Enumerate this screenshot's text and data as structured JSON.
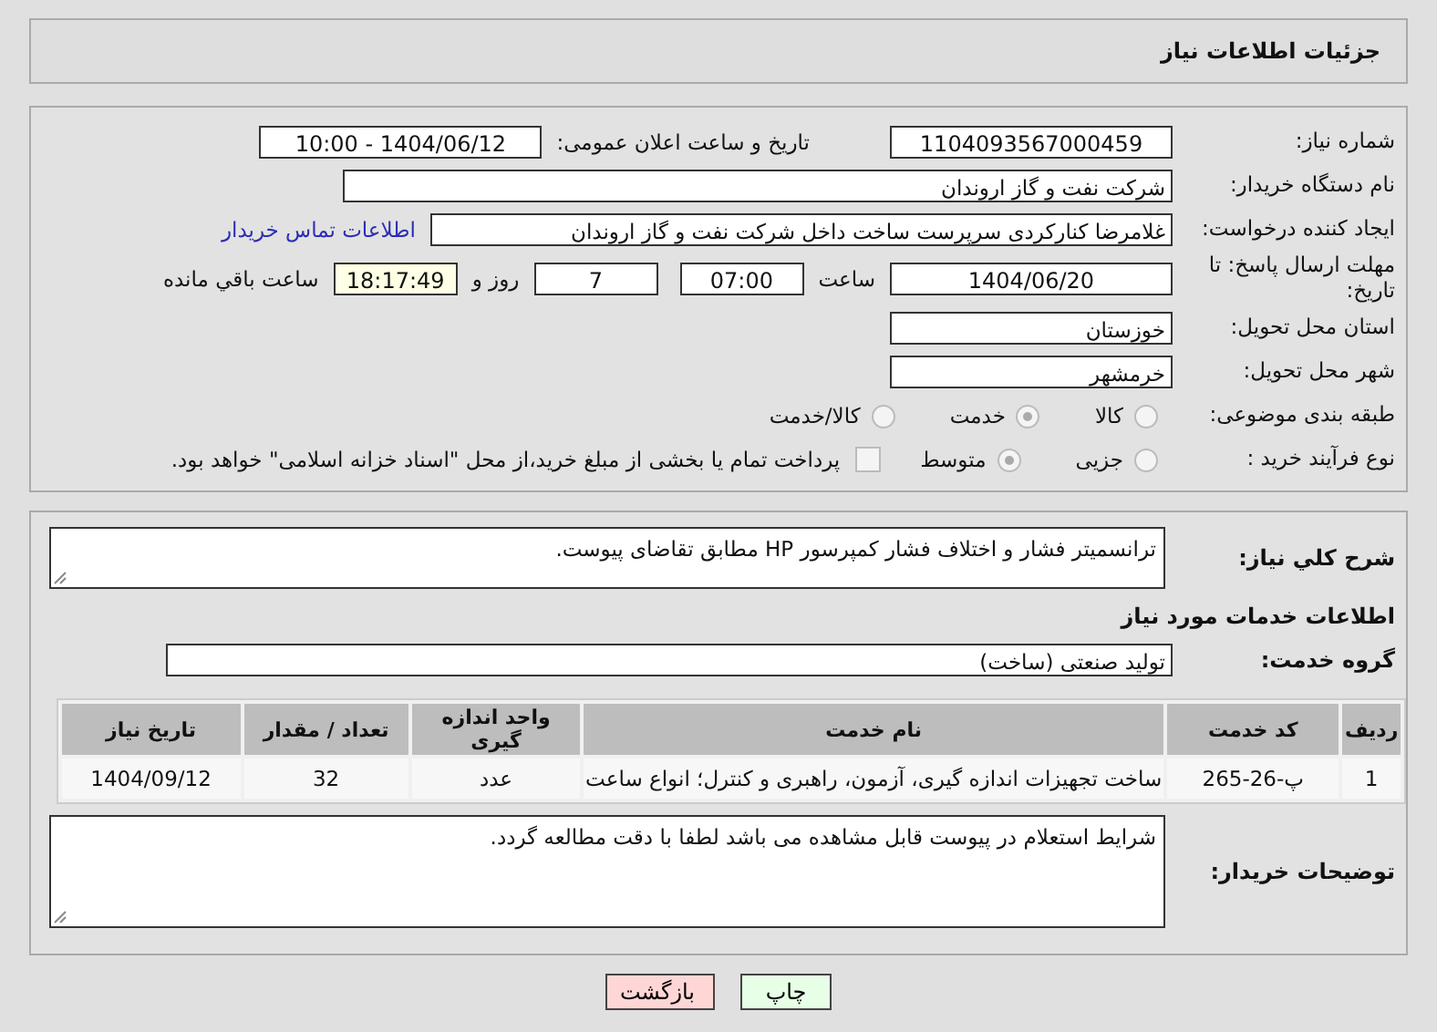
{
  "header": {
    "title": "جزئیات اطلاعات نیاز"
  },
  "need_number": {
    "label": "شماره نیاز:",
    "value": "1104093567000459"
  },
  "announce": {
    "label": "تاریخ و ساعت اعلان عمومی:",
    "value": "1404/06/12 - 10:00"
  },
  "buyer_org": {
    "label": "نام دستگاه خریدار:",
    "value": "شرکت نفت و گاز اروندان"
  },
  "creator": {
    "label": "ایجاد کننده درخواست:",
    "value": "غلامرضا کنارکردی سرپرست ساخت داخل شرکت نفت و گاز اروندان",
    "link": "اطلاعات تماس خریدار"
  },
  "deadline": {
    "label": "مهلت ارسال پاسخ: تا تاریخ:",
    "date": "1404/06/20",
    "time_label": "ساعت",
    "time": "07:00",
    "days": "7",
    "days_label": "روز و",
    "remaining": "18:17:49",
    "remaining_label": "ساعت باقي مانده"
  },
  "province": {
    "label": "استان محل تحویل:",
    "value": "خوزستان"
  },
  "city": {
    "label": "شهر محل تحویل:",
    "value": "خرمشهر"
  },
  "category": {
    "label": "طبقه بندی موضوعی:",
    "options": [
      {
        "label": "کالا",
        "selected": false
      },
      {
        "label": "خدمت",
        "selected": true
      },
      {
        "label": "کالا/خدمت",
        "selected": false
      }
    ]
  },
  "process": {
    "label": "نوع فرآیند خرید :",
    "options": [
      {
        "label": "جزیی",
        "selected": false
      },
      {
        "label": "متوسط",
        "selected": true
      }
    ],
    "treasury": {
      "checked": false,
      "label": "پرداخت تمام یا بخشی از مبلغ خرید،از محل \"اسناد خزانه اسلامی\" خواهد بود."
    }
  },
  "description": {
    "label": "شرح کلي نياز:",
    "value": "ترانسمیتر فشار و اختلاف فشار کمپرسور HP  مطابق تقاضای پیوست."
  },
  "services_heading": "اطلاعات خدمات مورد نیاز",
  "service_group": {
    "label": "گروه خدمت:",
    "value": "تولید صنعتی (ساخت)"
  },
  "table": {
    "columns": [
      "ردیف",
      "کد خدمت",
      "نام خدمت",
      "واحد اندازه گیری",
      "تعداد / مقدار",
      "تاریخ نیاز"
    ],
    "rows": [
      [
        "1",
        "پ-26-265",
        "ساخت تجهیزات اندازه گیری، آزمون، راهبری و کنترل؛ انواع ساعت",
        "عدد",
        "32",
        "1404/09/12"
      ]
    ]
  },
  "buyer_notes": {
    "label": "توضیحات خریدار:",
    "value": "شرایط استعلام در پیوست قابل مشاهده می باشد لطفا با دقت مطالعه گردد."
  },
  "buttons": [
    {
      "label": "چاپ",
      "kind": "print"
    },
    {
      "label": "بازگشت",
      "kind": "back"
    }
  ]
}
